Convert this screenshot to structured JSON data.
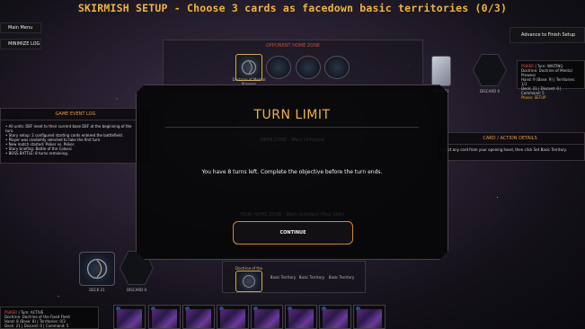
{
  "header": {
    "title": "SKIRMISH SETUP - Choose 3 cards as facedown basic territories (0/3)"
  },
  "controls": {
    "main_menu": "Main Menu",
    "minimize_log": "MINIMIZE LOG",
    "advance": "Advance to Finish Setup"
  },
  "opponent_zone": {
    "label": "OPPONENT HOME ZONE",
    "territory_caption": "Doctrine of Mental Prowess",
    "deck_label": "DECK 21",
    "discard_label": "DISCARD 0"
  },
  "opponent_status": {
    "player": "PSIKER",
    "turn": "Turn: WAITING",
    "doctrine": "Doctrine: Doctrine of Mental Prowess",
    "hand": "Hand: 9 (Base: 9)",
    "territories": "Territories: 1/1",
    "deck": "Deck: 21",
    "discard": "Discard: 0",
    "command": "Command: 5",
    "phase": "Phase: SETUP"
  },
  "game_log": {
    "title": "GAME EVENT LOG",
    "lines": [
      "• All units: DEF reset to their current base DEF at the beginning of the",
      "turn.",
      "• Story setup: 2 configured starting cards entered the battlefield.",
      "• Player was randomly selected to take the first turn.",
      "• New match started: Psiker vs. Psiker.",
      "• Story briefing: Battle of the Colossi",
      "• BOSS BATTLE: 8 turns remaining."
    ]
  },
  "card_action": {
    "title": "CARD / ACTION DETAILS",
    "text": "Select any card from your opening hand, then click Set Basic Territory."
  },
  "modal": {
    "title": "TURN LIMIT",
    "ghost_open_zone": "OPEN ZONE - Wars Unfolded",
    "ghost_home_zone": "YOUR HOME ZONE - Wars Unfolded (Your Side)",
    "message": "You have 8 turns left. Complete the objective before the turn ends.",
    "continue": "CONTINUE"
  },
  "player_zone": {
    "deck_label": "DECK 21",
    "discard_label": "DISCARD 0",
    "territory_caption": "Doctrine of the Fixed Flesh",
    "slot_labels": [
      "Basic Territory",
      "Basic Territory",
      "Basic Territory"
    ]
  },
  "player_status": {
    "player": "PSIKER",
    "turn": "Turn: ACTIVE",
    "doctrine": "Doctrine: Doctrine of the Fixed Flesh",
    "hand": "Hand: 8 (Base: 8)",
    "territories": "Territories: 0/3",
    "deck": "Deck: 21",
    "discard": "Discard: 0",
    "command": "Command: 5"
  },
  "hand_cards": [
    {
      "name": "hand-card-1"
    },
    {
      "name": "hand-card-2"
    },
    {
      "name": "hand-card-3"
    },
    {
      "name": "hand-card-4"
    },
    {
      "name": "hand-card-5"
    },
    {
      "name": "hand-card-6"
    },
    {
      "name": "hand-card-7"
    },
    {
      "name": "hand-card-8"
    }
  ],
  "colors": {
    "accent": "#f0b43a",
    "zone_label": "#c84a3a",
    "panel_head": "#e29b4a",
    "continue_border": "#d0892e"
  }
}
